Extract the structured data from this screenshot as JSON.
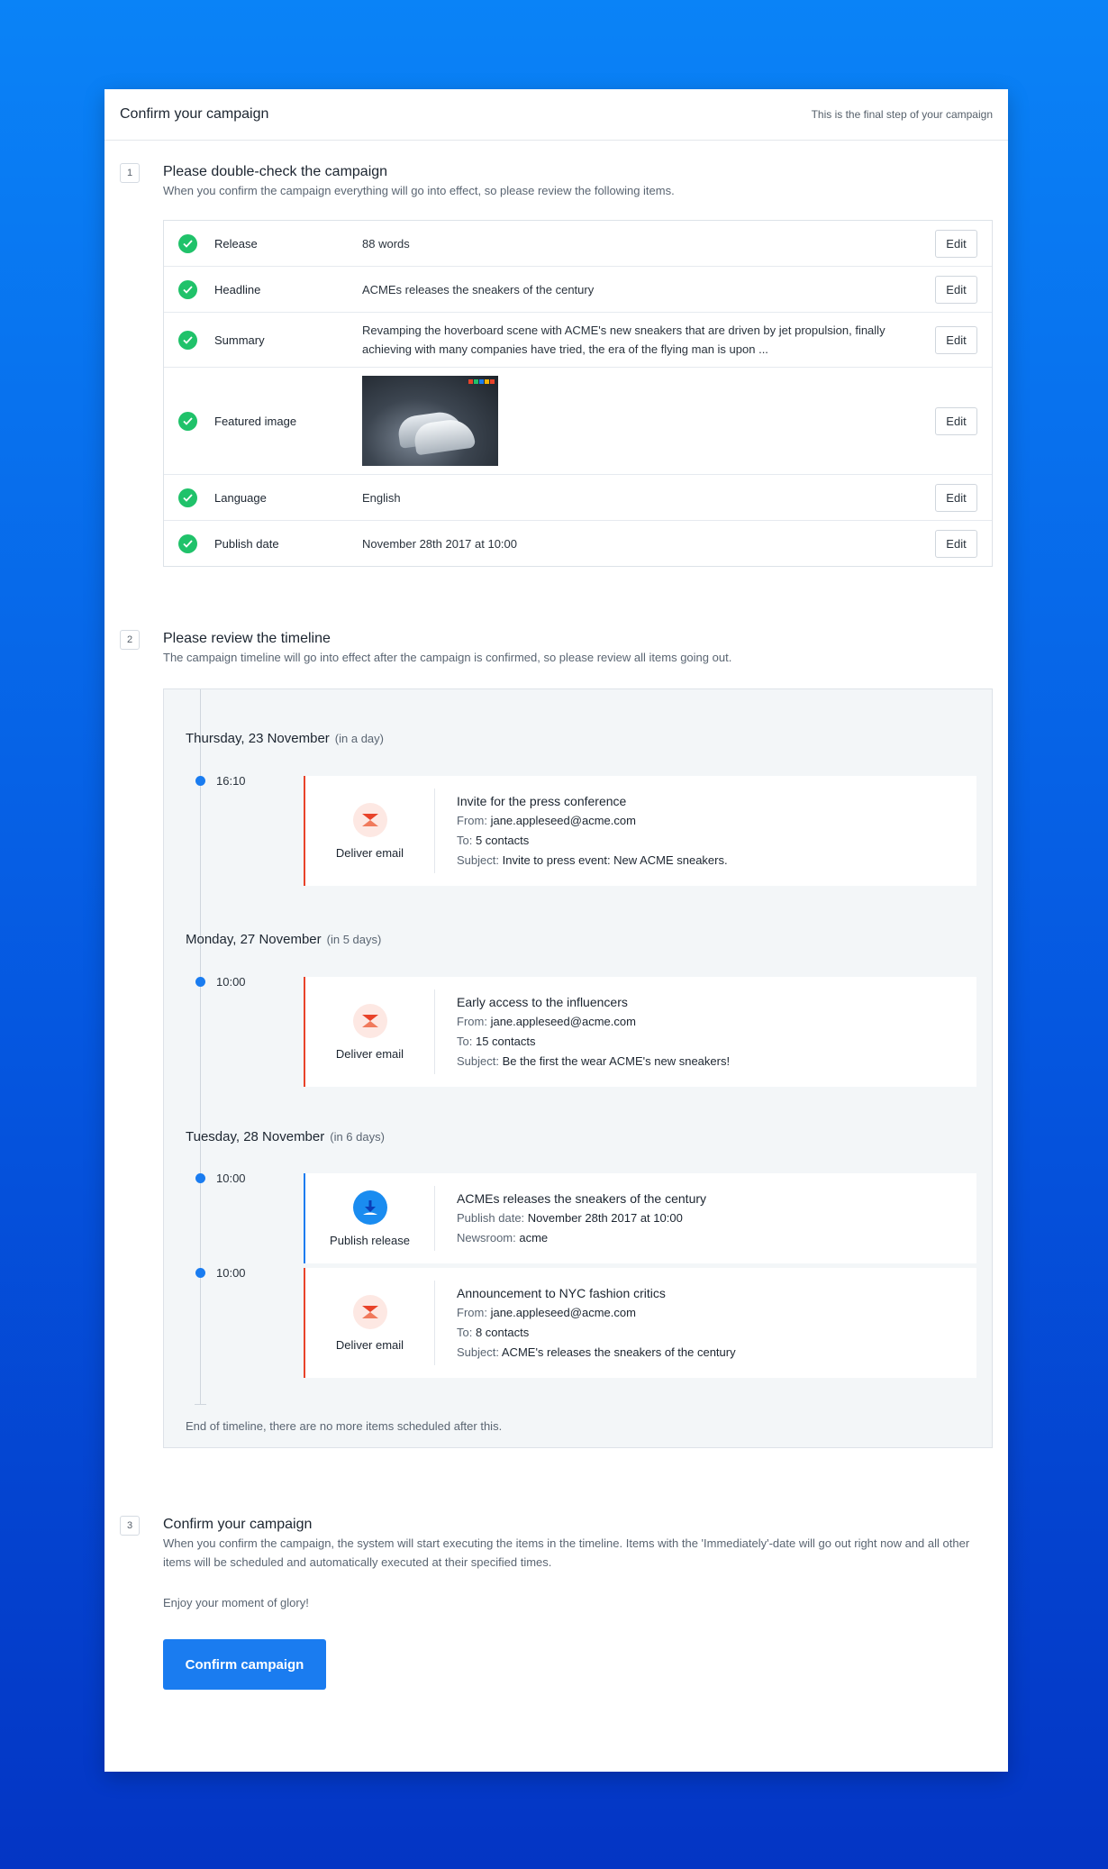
{
  "header": {
    "title": "Confirm your campaign",
    "hint": "This is the final step of your campaign"
  },
  "step1": {
    "number": "1",
    "title": "Please double-check the campaign",
    "desc": "When you confirm the campaign everything will go into effect, so please review the following items.",
    "edit_label": "Edit",
    "rows": [
      {
        "label": "Release",
        "value": "88 words"
      },
      {
        "label": "Headline",
        "value": "ACMEs releases the sneakers of the century"
      },
      {
        "label": "Summary",
        "value": "Revamping the hoverboard scene with ACME's new sneakers that are driven by jet propulsion, finally achieving with many companies have tried, the era of the flying man is upon ..."
      },
      {
        "label": "Featured image",
        "value": ""
      },
      {
        "label": "Language",
        "value": "English"
      },
      {
        "label": "Publish date",
        "value": "November 28th 2017 at 10:00"
      }
    ]
  },
  "step2": {
    "number": "2",
    "title": "Please review the timeline",
    "desc": "The campaign timeline will go into effect after the campaign is confirmed, so please review all items going out.",
    "days": [
      {
        "date": "Thursday, 23 November",
        "relative": "(in a day)"
      },
      {
        "date": "Monday, 27 November",
        "relative": "(in 5 days)"
      },
      {
        "date": "Tuesday, 28 November",
        "relative": "(in 6 days)"
      }
    ],
    "events": [
      {
        "time": "16:10",
        "kind": "Deliver email",
        "title": "Invite for the press conference",
        "from_label": "From:",
        "from": "jane.appleseed@acme.com",
        "to_label": "To:",
        "to": "5 contacts",
        "subject_label": "Subject:",
        "subject": "Invite to press event: New ACME sneakers."
      },
      {
        "time": "10:00",
        "kind": "Deliver email",
        "title": "Early access to the influencers",
        "from_label": "From:",
        "from": "jane.appleseed@acme.com",
        "to_label": "To:",
        "to": "15 contacts",
        "subject_label": "Subject:",
        "subject": "Be the first the wear ACME's new sneakers!"
      },
      {
        "time": "10:00",
        "kind": "Publish release",
        "title": "ACMEs releases the sneakers of the century",
        "date_label": "Publish date:",
        "date": "November 28th 2017 at 10:00",
        "newsroom_label": "Newsroom:",
        "newsroom": "acme"
      },
      {
        "time": "10:00",
        "kind": "Deliver email",
        "title": "Announcement to NYC fashion critics",
        "from_label": "From:",
        "from": "jane.appleseed@acme.com",
        "to_label": "To:",
        "to": "8 contacts",
        "subject_label": "Subject:",
        "subject": "ACME's releases the sneakers of the century"
      }
    ],
    "footer": "End of timeline, there are no more items scheduled after this."
  },
  "step3": {
    "number": "3",
    "title": "Confirm your campaign",
    "desc": "When you confirm the campaign, the system will start executing the items in the timeline. Items with the 'Immediately'-date will go out right now and all other items will be scheduled and automatically executed at their specified times.",
    "enjoy": "Enjoy your moment of glory!",
    "button": "Confirm campaign"
  },
  "colors": {
    "accent": "#1a7cf0",
    "success": "#20c26a",
    "email": "#e8432a"
  },
  "icons": {
    "check": "check-icon",
    "email": "email-icon",
    "publish": "publish-icon"
  }
}
